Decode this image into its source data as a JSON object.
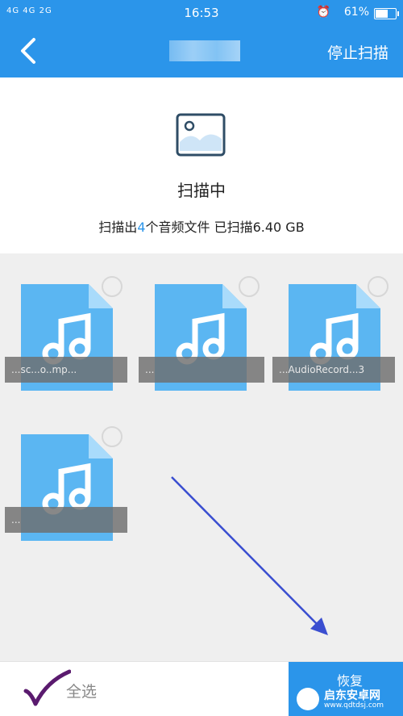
{
  "status_bar": {
    "signal": "4G 4G 2G",
    "time": "16:53",
    "battery_percent": "61%",
    "battery_level": 0.61
  },
  "nav": {
    "stop_label": "停止扫描"
  },
  "scan": {
    "title": "扫描中",
    "summary_prefix": "扫描出",
    "found_count": "4",
    "summary_middle": "个音频文件 已扫描",
    "scanned_size": "6.40 GB"
  },
  "files": [
    {
      "name": "...sc...o..mp..."
    },
    {
      "name": "..."
    },
    {
      "name": "...AudioRecord...3"
    },
    {
      "name": "..."
    }
  ],
  "bottom": {
    "select_all": "全选",
    "recover_label": "恢复"
  },
  "watermark": {
    "brand": "启东安卓网",
    "url": "www.qdtdsj.com"
  },
  "colors": {
    "accent": "#2b95ea",
    "file_blue": "#5bb6f2",
    "grid_bg": "#efefef",
    "arrow": "#3a4ed0",
    "tick": "#5a1a6e"
  }
}
